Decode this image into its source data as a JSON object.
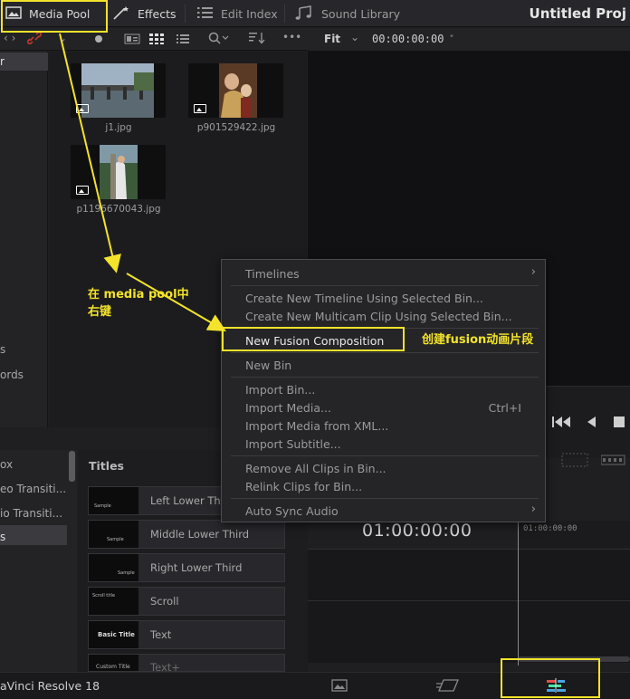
{
  "topbar": {
    "media_pool": "Media Pool",
    "effects": "Effects",
    "edit_index": "Edit Index",
    "sound_library": "Sound Library",
    "app_title": "Untitled Proj"
  },
  "subbar": {
    "fit": "Fit",
    "timecode": "00:00:00:00"
  },
  "bins": {
    "selected": "r",
    "item_s": "s",
    "item_ords": "ords"
  },
  "media": [
    {
      "name": "j1.jpg"
    },
    {
      "name": "p901529422.jpg"
    },
    {
      "name": "p1196670043.jpg"
    }
  ],
  "effects_library": {
    "left_items": [
      "ox",
      "eo Transiti...",
      "io Transiti...",
      "s"
    ],
    "header": "Titles",
    "titles": [
      {
        "name": "Left Lower Third",
        "thumb": "Sample"
      },
      {
        "name": "Middle Lower Third",
        "thumb": "Sample"
      },
      {
        "name": "Right Lower Third",
        "thumb": "Sample"
      },
      {
        "name": "Scroll",
        "thumb": "Scroll title"
      },
      {
        "name": "Text",
        "thumb": "Basic Title"
      },
      {
        "name": "Text+",
        "thumb": "Custom Title"
      }
    ]
  },
  "timeline": {
    "timecode": "01:00:00:00",
    "ruler_label": "01:00:00:00"
  },
  "bottombar": {
    "brand": "aVinci Resolve 18"
  },
  "context_menu": {
    "timelines": "Timelines",
    "create_timeline": "Create New Timeline Using Selected Bin...",
    "create_multicam": "Create New Multicam Clip Using Selected Bin...",
    "new_fusion": "New Fusion Composition",
    "new_bin": "New Bin",
    "import_bin": "Import Bin...",
    "import_media": "Import Media...",
    "import_media_shortcut": "Ctrl+I",
    "import_xml": "Import Media from XML...",
    "import_subtitle": "Import Subtitle...",
    "remove_all": "Remove All Clips in Bin...",
    "relink": "Relink Clips for Bin...",
    "auto_sync": "Auto Sync Audio"
  },
  "annotations": {
    "right_click_line1": "在 media pool中",
    "right_click_line2": "右键",
    "fusion_note": "创建fusion动画片段",
    "highlight_color": "#f3e32a"
  },
  "colors": {
    "panel": "#232326",
    "viewer": "#111113",
    "menu": "#252528"
  }
}
